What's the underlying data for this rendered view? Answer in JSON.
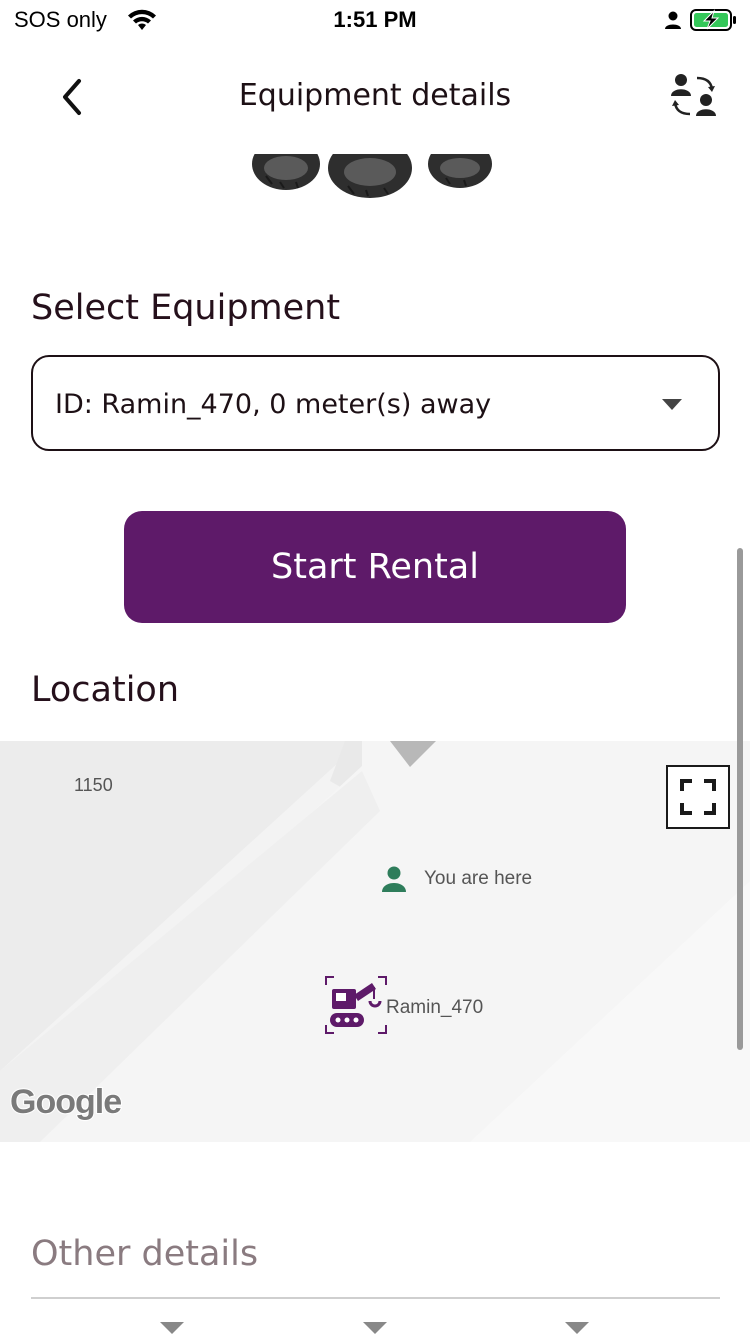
{
  "status_bar": {
    "carrier": "SOS only",
    "time": "1:51 PM"
  },
  "header": {
    "title": "Equipment details",
    "back_icon": "chevron-left-icon",
    "switch_icon": "switch-users-icon"
  },
  "select_section": {
    "title": "Select Equipment",
    "selected_value": "ID: Ramin_470, 0 meter(s) away"
  },
  "actions": {
    "start_rental_label": "Start Rental"
  },
  "location": {
    "title": "Location",
    "street_number": "1150",
    "you_are_here": "You are here",
    "equipment_marker_label": "Ramin_470",
    "attribution": "Google"
  },
  "other_details": {
    "title": "Other details"
  },
  "colors": {
    "primary": "#5e1a69",
    "text": "#1d1015",
    "user_marker": "#2e7d5b"
  }
}
